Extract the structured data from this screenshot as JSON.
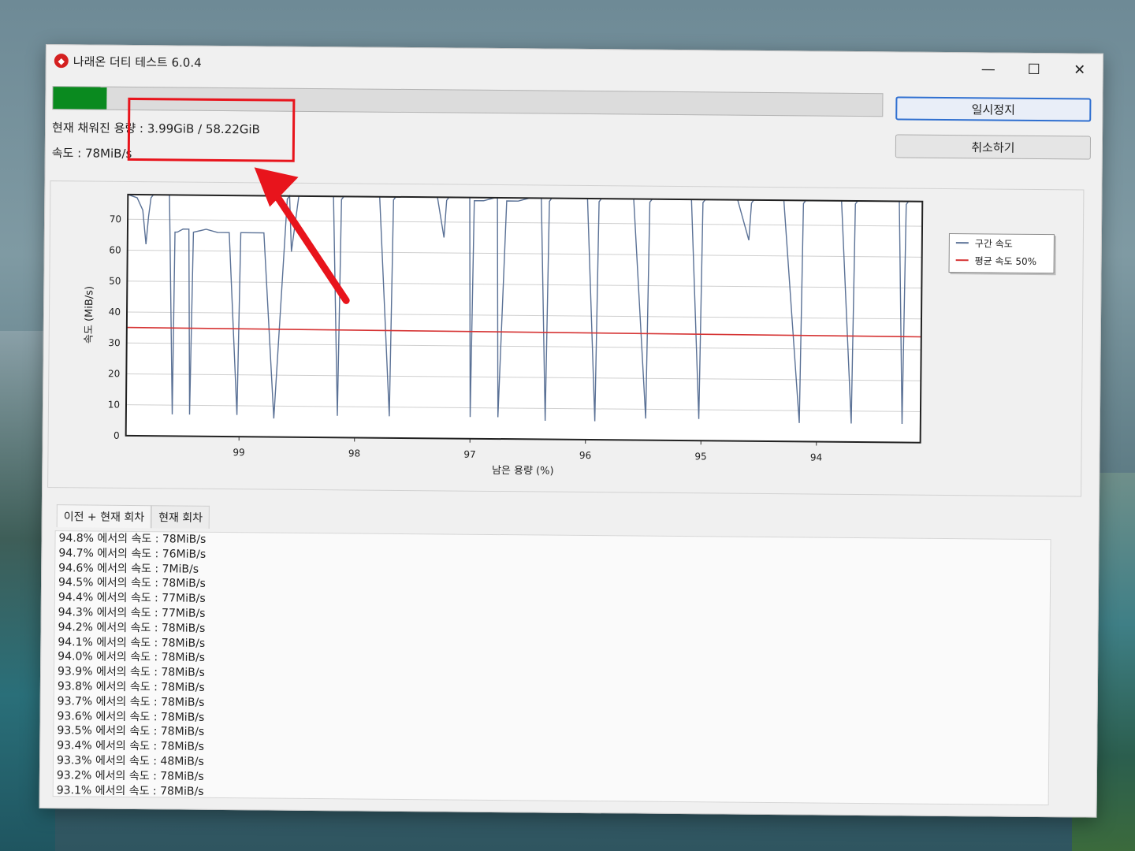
{
  "window": {
    "title": "나래온 더티 테스트 6.0.4",
    "controls": [
      "—",
      "☐",
      "✕"
    ]
  },
  "progress": {
    "fraction": 0.065,
    "color": "#0a8a1f"
  },
  "status": {
    "filled_label": "현재 채워진 용량 : 3.99GiB / 58.22GiB",
    "speed_label": "속도 : 78MiB/s"
  },
  "buttons": {
    "pause": "일시정지",
    "cancel": "취소하기"
  },
  "chart_data": {
    "type": "line",
    "title": "",
    "xlabel": "남은 용량 (%)",
    "ylabel": "속도 (MiB/s)",
    "xlim": [
      99.98,
      93.1
    ],
    "ylim": [
      0,
      78
    ],
    "yticks": [
      0,
      10,
      20,
      30,
      40,
      50,
      60,
      70
    ],
    "xticks": [
      99,
      98,
      97,
      96,
      95,
      94
    ],
    "grid": true,
    "legend": "right",
    "series": [
      {
        "name": "구간 속도",
        "color": "#5a7196",
        "x": [
          99.98,
          99.9,
          99.85,
          99.82,
          99.8,
          99.78,
          99.76,
          99.7,
          99.62,
          99.58,
          99.57,
          99.55,
          99.5,
          99.45,
          99.43,
          99.41,
          99.3,
          99.2,
          99.1,
          99.02,
          99.0,
          98.98,
          98.9,
          98.8,
          98.7,
          98.6,
          98.58,
          98.56,
          98.5,
          98.4,
          98.3,
          98.2,
          98.15,
          98.13,
          98.11,
          98.05,
          98.0,
          97.95,
          97.9,
          97.85,
          97.8,
          97.7,
          97.68,
          97.66,
          97.6,
          97.5,
          97.4,
          97.3,
          97.24,
          97.22,
          97.2,
          97.1,
          97.02,
          97.0,
          96.98,
          96.9,
          96.8,
          96.78,
          96.76,
          96.7,
          96.6,
          96.5,
          96.4,
          96.35,
          96.33,
          96.31,
          96.2,
          96.1,
          96.0,
          95.92,
          95.9,
          95.88,
          95.8,
          95.7,
          95.6,
          95.48,
          95.46,
          95.44,
          95.3,
          95.2,
          95.1,
          95.02,
          95.0,
          94.98,
          94.9,
          94.8,
          94.7,
          94.6,
          94.58,
          94.56,
          94.5,
          94.4,
          94.3,
          94.15,
          94.13,
          94.11,
          94.0,
          93.9,
          93.8,
          93.7,
          93.68,
          93.66,
          93.5,
          93.4,
          93.3,
          93.26,
          93.24,
          93.22,
          93.1
        ],
        "y": [
          78,
          77,
          73,
          62,
          71,
          77,
          78,
          78,
          78,
          7,
          66,
          66,
          67,
          67,
          7,
          66,
          67,
          66,
          66,
          7,
          66,
          66,
          66,
          66,
          6,
          77,
          78,
          60,
          78,
          78,
          78,
          78,
          7,
          77,
          78,
          78,
          78,
          78,
          78,
          78,
          78,
          7,
          77,
          78,
          78,
          78,
          78,
          78,
          65,
          77,
          78,
          78,
          78,
          7,
          77,
          77,
          78,
          78,
          7,
          77,
          77,
          78,
          78,
          6,
          77,
          78,
          78,
          78,
          78,
          6,
          77,
          78,
          78,
          78,
          78,
          7,
          77,
          78,
          78,
          78,
          78,
          7,
          77,
          78,
          78,
          78,
          78,
          65,
          77,
          78,
          78,
          78,
          78,
          6,
          77,
          78,
          78,
          78,
          78,
          6,
          77,
          78,
          78,
          78,
          78,
          6,
          77,
          78,
          78
        ]
      },
      {
        "name": "평균 속도 50%",
        "color": "#d63434",
        "x": [
          99.98,
          93.1
        ],
        "y": [
          35,
          34.2
        ]
      }
    ]
  },
  "tabs": [
    {
      "label": "이전 + 현재 회차",
      "active": true
    },
    {
      "label": "현재 회차",
      "active": false
    }
  ],
  "log": [
    "94.8% 에서의 속도 : 78MiB/s",
    "94.7% 에서의 속도 : 76MiB/s",
    "94.6% 에서의 속도 : 7MiB/s",
    "94.5% 에서의 속도 : 78MiB/s",
    "94.4% 에서의 속도 : 77MiB/s",
    "94.3% 에서의 속도 : 77MiB/s",
    "94.2% 에서의 속도 : 78MiB/s",
    "94.1% 에서의 속도 : 78MiB/s",
    "94.0% 에서의 속도 : 78MiB/s",
    "93.9% 에서의 속도 : 78MiB/s",
    "93.8% 에서의 속도 : 78MiB/s",
    "93.7% 에서의 속도 : 78MiB/s",
    "93.6% 에서의 속도 : 78MiB/s",
    "93.5% 에서의 속도 : 78MiB/s",
    "93.4% 에서의 속도 : 78MiB/s",
    "93.3% 에서의 속도 : 48MiB/s",
    "93.2% 에서의 속도 : 78MiB/s",
    "93.1% 에서의 속도 : 78MiB/s"
  ],
  "annotation": {
    "color": "#e8141c",
    "icon": "red-arrow-icon"
  }
}
